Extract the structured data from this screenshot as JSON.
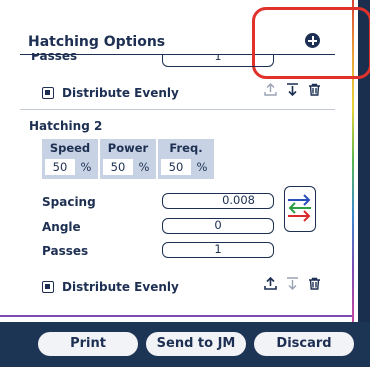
{
  "header": {
    "title": "Hatching Options",
    "add_icon": "plus-circle-icon"
  },
  "passes_partial": {
    "label": "Passes",
    "value": "1"
  },
  "group1": {
    "distribute_label": "Distribute Evenly"
  },
  "hatching2": {
    "title": "Hatching 2",
    "speed": {
      "label": "Speed",
      "value": "50",
      "unit": "%"
    },
    "power": {
      "label": "Power",
      "value": "50",
      "unit": "%"
    },
    "freq": {
      "label": "Freq.",
      "value": "50",
      "unit": "%"
    },
    "spacing": {
      "label": "Spacing",
      "value": "0.008"
    },
    "angle": {
      "label": "Angle",
      "value": "0"
    },
    "passes": {
      "label": "Passes",
      "value": "1"
    },
    "distribute_label": "Distribute Evenly"
  },
  "buttons": {
    "print": "Print",
    "send": "Send to JM",
    "discard": "Discard"
  },
  "colors": {
    "navy": "#1d2f52",
    "highlight": "#e0312b",
    "table_bg": "#c7d3e4",
    "bar_bg": "#1d3555"
  }
}
